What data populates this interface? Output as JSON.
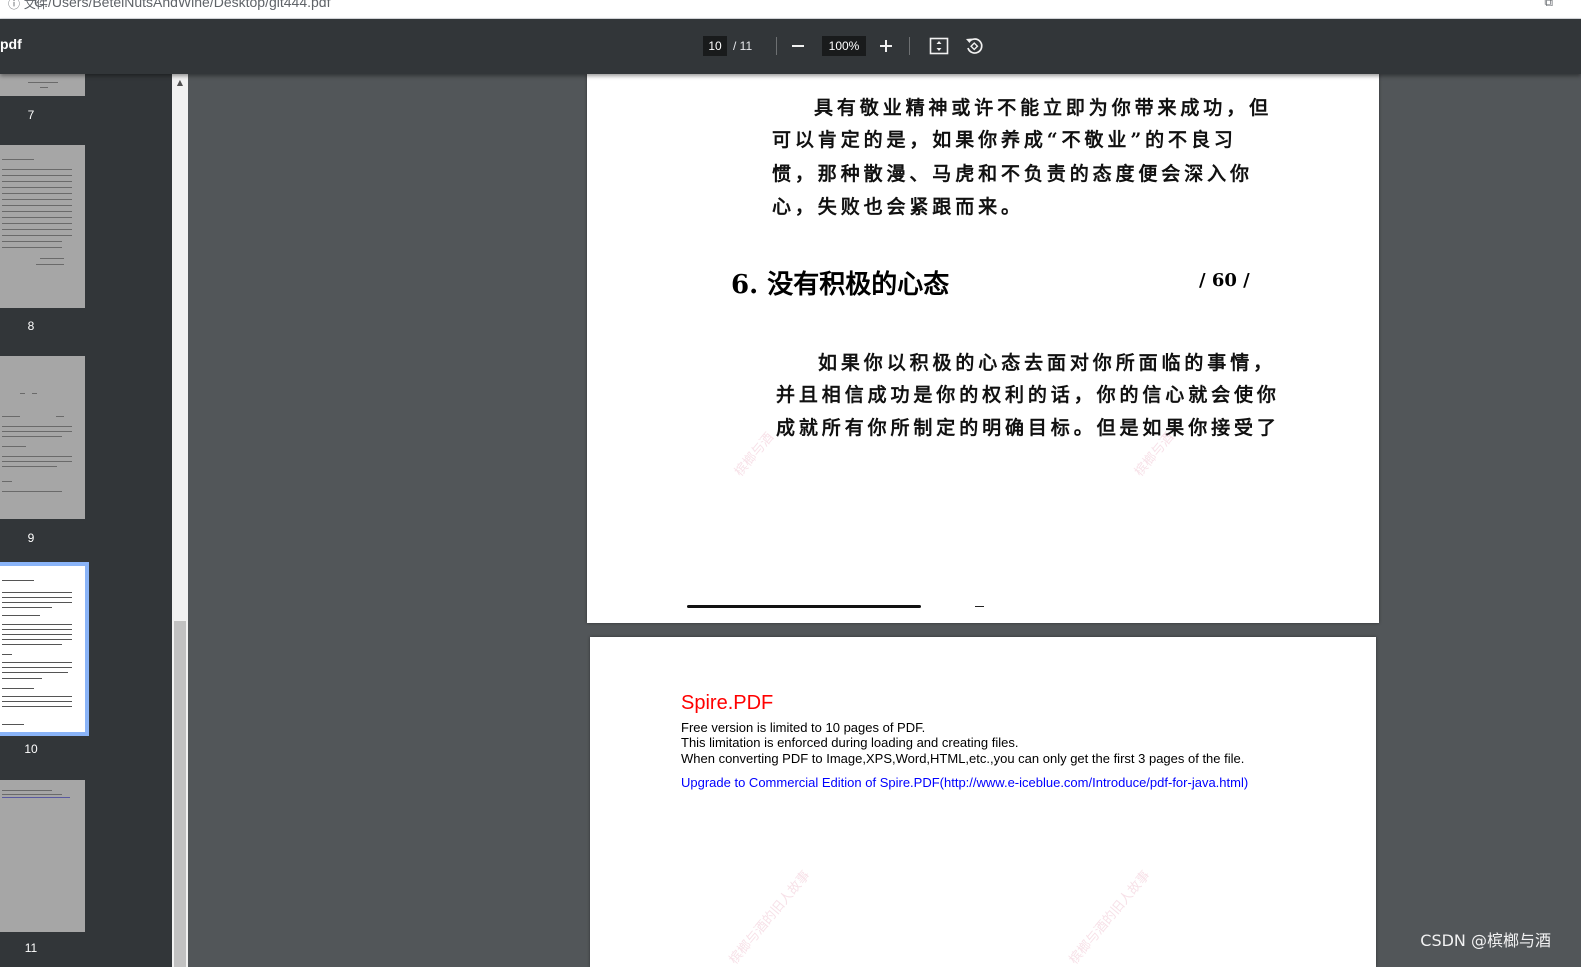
{
  "browser": {
    "info_label": "ⓘ 文件",
    "url": "C:/Users/BetelNutsAndWine/Desktop/git444.pdf"
  },
  "toolbar": {
    "title": "pdf",
    "current_page": "10",
    "total_pages": "/ 11",
    "zoom": "100%"
  },
  "sidebar": {
    "thumbnails": [
      {
        "label": "7"
      },
      {
        "label": "8"
      },
      {
        "label": "9"
      },
      {
        "label": "10"
      },
      {
        "label": "11"
      }
    ]
  },
  "page1": {
    "paragraph1": [
      "具有敬业精神或许不能立即为你带来成功，但",
      "可以肯定的是，如果你养成“不敬业”的不良习",
      "惯，那种散漫、马虎和不负责的态度便会深入你",
      "心，失败也会紧跟而来。"
    ],
    "heading": "6. 没有积极的心态",
    "page_marker": "/ 60 /",
    "paragraph2": [
      "如果你以积极的心态去面对你所面临的事情，",
      "并且相信成功是你的权利的话，你的信心就会使你",
      "成就所有你所制定的明确目标。但是如果你接受了"
    ],
    "watermark": "槟榔与酒"
  },
  "page2": {
    "title": "Spire.PDF",
    "lines": [
      "Free version is limited to 10 pages of PDF.",
      "This limitation is enforced during loading and creating files.",
      "When converting PDF to Image,XPS,Word,HTML,etc.,you can only get the first 3 pages of the file."
    ],
    "link": "Upgrade to Commercial Edition of Spire.PDF(http://www.e-iceblue.com/Introduce/pdf-for-java.html)",
    "watermark": "槟榔与酒的旧人故事"
  },
  "csdn_watermark": "CSDN @槟榔与酒",
  "colors": {
    "toolbar_bg": "#323639",
    "viewer_bg": "#525659",
    "active_thumb_outline": "#8ab4f8",
    "spire_red": "#ff0000",
    "link_blue": "#0000ff"
  }
}
